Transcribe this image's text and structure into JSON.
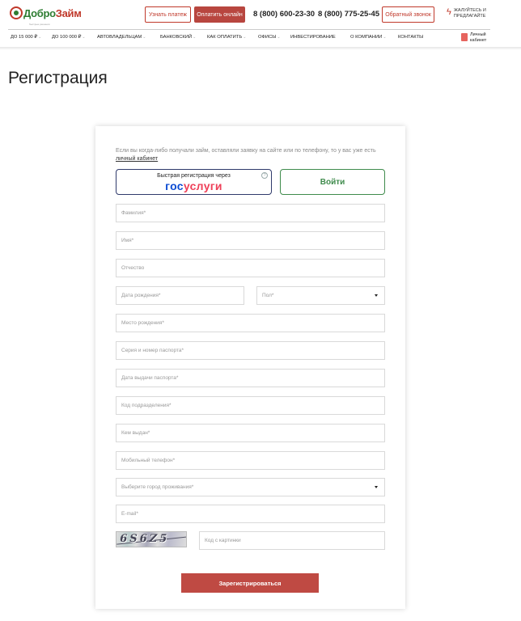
{
  "header": {
    "logo_part1": "Добро",
    "logo_part2": "Займ",
    "logo_tagline": "быстрые решения",
    "check_payment_label": "Узнать платеж",
    "pay_online_label": "Оплатить онлайн",
    "phone1": "8 (800) 600-23-30",
    "phone2": "8 (800) 775-25-45",
    "callback_label": "Обратный звонок",
    "complain_label": "Жалуйтесь и предлагайте",
    "cabinet_line1": "Личный",
    "cabinet_line2": "кабинет"
  },
  "nav": {
    "items": [
      {
        "label": "до 15 000 ₽"
      },
      {
        "label": "до 100 000 ₽"
      },
      {
        "label": "Автовладельцам"
      },
      {
        "label": "Банковский"
      },
      {
        "label": "Как оплатить"
      },
      {
        "label": "Офисы"
      },
      {
        "label": "Инвестирование"
      },
      {
        "label": "О компании"
      },
      {
        "label": "Контакты"
      }
    ]
  },
  "page": {
    "title": "Регистрация"
  },
  "form": {
    "intro_text": "Если вы когда-либо получали займ, оставляли заявку на сайте или по телефону, то у вас уже есть ",
    "intro_link": "личный кабинет",
    "gosuslugi_caption": "Быстрая регистрация через",
    "gosuslugi_logo_a": "гос",
    "gosuslugi_logo_b": "услуги",
    "login_label": "Войти",
    "fields": {
      "surname": "Фамилия*",
      "name": "Имя*",
      "patronymic": "Отчество",
      "birth_date": "Дата рождения*",
      "gender": "Пол*",
      "birth_place": "Место рождения*",
      "passport": "Серия и номер паспорта*",
      "issue_date": "Дата выдачи паспорта*",
      "division_code": "Код подразделения*",
      "issued_by": "Кем выдан*",
      "mobile": "Мобильный телефон*",
      "city": "Выберите город проживания*",
      "email": "E-mail*",
      "captcha_code": "Код с картинки"
    },
    "captcha_image_text": "6S6Z5",
    "submit_label": "Зарегистрироваться"
  }
}
